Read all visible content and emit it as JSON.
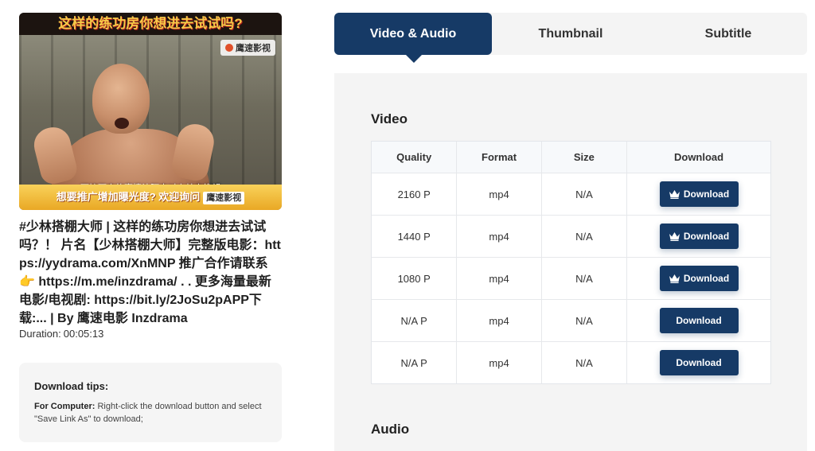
{
  "thumbnail": {
    "top_caption": "这样的练功房你想进去试试吗?",
    "logo_text": "鹰速影视",
    "scene_subtitle": "可接下来的事情让阿杰对少林寺绝望",
    "bottom_banner": "想要推广增加曝光度? 欢迎询问",
    "bottom_logo": "鹰速影视"
  },
  "video": {
    "title": "#少林搭棚大师 | 这样的练功房你想进去试试吗？！ 片名【少林搭棚大师】完整版电影：https://yydrama.com/XnMNP 推广合作请联系 👉 https://m.me/inzdrama/ . . 更多海量最新电影/电视剧: https://bit.ly/2JoSu2pAPP下载:... | By 鹰速电影 Inzdrama",
    "duration_label": "Duration:",
    "duration_value": "00:05:13"
  },
  "tips": {
    "title": "Download tips:",
    "computer_label": "For Computer:",
    "computer_text": "Right-click the download button and select \"Save Link As\" to download;"
  },
  "tabs": [
    {
      "label": "Video & Audio",
      "active": true
    },
    {
      "label": "Thumbnail",
      "active": false
    },
    {
      "label": "Subtitle",
      "active": false
    }
  ],
  "video_section": {
    "title": "Video",
    "headers": {
      "quality": "Quality",
      "format": "Format",
      "size": "Size",
      "download": "Download"
    },
    "rows": [
      {
        "quality": "2160 P",
        "format": "mp4",
        "size": "N/A",
        "button": "Download",
        "premium": true
      },
      {
        "quality": "1440 P",
        "format": "mp4",
        "size": "N/A",
        "button": "Download",
        "premium": true
      },
      {
        "quality": "1080 P",
        "format": "mp4",
        "size": "N/A",
        "button": "Download",
        "premium": true
      },
      {
        "quality": "N/A P",
        "format": "mp4",
        "size": "N/A",
        "button": "Download",
        "premium": false
      },
      {
        "quality": "N/A P",
        "format": "mp4",
        "size": "N/A",
        "button": "Download",
        "premium": false
      }
    ]
  },
  "audio_section": {
    "title": "Audio"
  },
  "colors": {
    "accent": "#163a66",
    "panel_bg": "#f4f4f4"
  },
  "icons": {
    "premium": "crown-icon"
  }
}
